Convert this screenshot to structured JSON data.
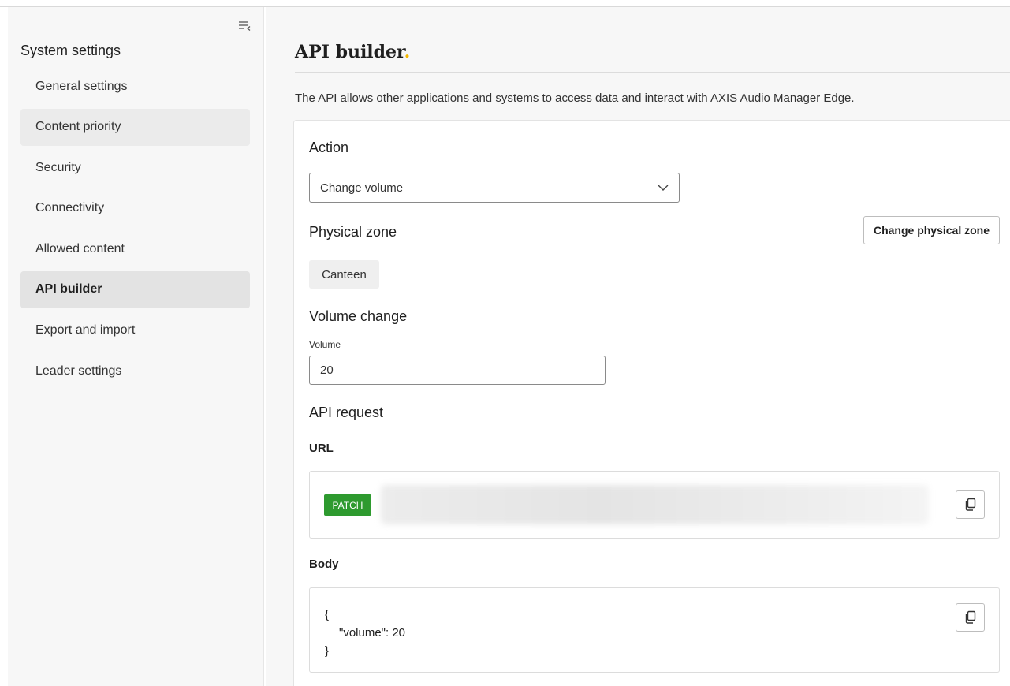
{
  "sidebar": {
    "title": "System settings",
    "items": [
      {
        "label": "General settings"
      },
      {
        "label": "Content priority"
      },
      {
        "label": "Security"
      },
      {
        "label": "Connectivity"
      },
      {
        "label": "Allowed content"
      },
      {
        "label": "API builder"
      },
      {
        "label": "Export and import"
      },
      {
        "label": "Leader settings"
      }
    ]
  },
  "main": {
    "title": "API builder",
    "title_dot": ".",
    "description": "The API allows other applications and systems to access data and interact with AXIS Audio Manager Edge.",
    "action": {
      "heading": "Action",
      "selected": "Change volume"
    },
    "physical_zone": {
      "heading": "Physical zone",
      "button_label": "Change physical zone",
      "zone": "Canteen"
    },
    "volume_change": {
      "heading": "Volume change",
      "field_label": "Volume",
      "value": "20"
    },
    "api_request": {
      "heading": "API request",
      "url_label": "URL",
      "method": "PATCH",
      "body_label": "Body",
      "body_open": "{",
      "body_line": "\"volume\": 20",
      "body_close": "}"
    }
  },
  "colors": {
    "accent_dot": "#f5b800",
    "patch_badge": "#2e9a2f"
  },
  "icons": {
    "collapse": "collapse-menu-icon",
    "dropdown": "chevron-down-icon",
    "copy": "copy-icon"
  }
}
